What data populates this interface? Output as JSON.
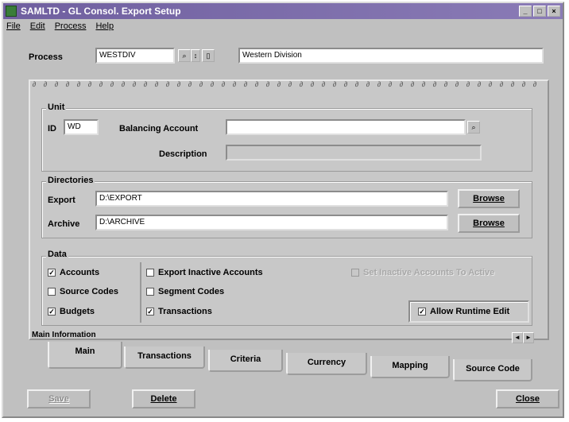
{
  "window": {
    "title": "SAMLTD - GL Consol. Export Setup"
  },
  "menu": [
    "File",
    "Edit",
    "Process",
    "Help"
  ],
  "process": {
    "label": "Process",
    "code": "WESTDIV",
    "description": "Western Division"
  },
  "unit": {
    "group_label": "Unit",
    "id_label": "ID",
    "id_value": "WD",
    "balancing_label": "Balancing Account",
    "balancing_value": "",
    "description_label": "Description",
    "description_value": ""
  },
  "directories": {
    "group_label": "Directories",
    "export_label": "Export",
    "export_value": "D:\\EXPORT",
    "archive_label": "Archive",
    "archive_value": "D:\\ARCHIVE",
    "browse_label": "Browse"
  },
  "data_group": {
    "group_label": "Data",
    "checkboxes": {
      "accounts": {
        "label": "Accounts",
        "checked": true
      },
      "source_codes": {
        "label": "Source Codes",
        "checked": false
      },
      "budgets": {
        "label": "Budgets",
        "checked": true
      },
      "export_inactive": {
        "label": "Export Inactive Accounts",
        "checked": false
      },
      "segment_codes": {
        "label": "Segment Codes",
        "checked": false
      },
      "transactions": {
        "label": "Transactions",
        "checked": true
      },
      "set_inactive": {
        "label": "Set Inactive Accounts To Active",
        "checked": false
      },
      "allow_runtime": {
        "label": "Allow Runtime Edit",
        "checked": true
      }
    }
  },
  "status_label": "Main Information",
  "tabs": [
    "Main",
    "Transactions",
    "Criteria",
    "Currency",
    "Mapping",
    "Source Code"
  ],
  "buttons": {
    "save": "Save",
    "delete": "Delete",
    "close": "Close"
  }
}
